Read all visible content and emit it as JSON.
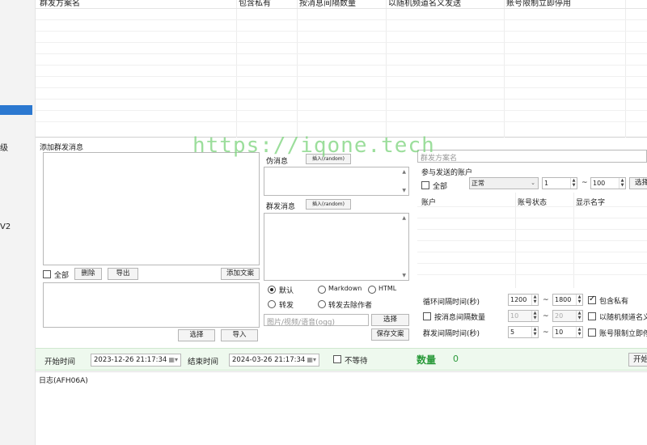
{
  "sidebar": {
    "items": [
      "级",
      "V2"
    ]
  },
  "top_grid": {
    "columns": [
      "群发方案名",
      "包含私有",
      "按消息间隔数量",
      "以随机频道名义发送",
      "账号限制立即停用"
    ]
  },
  "compose": {
    "title": "添加群发消息",
    "select_all": "全部",
    "delete": "删除",
    "export": "导出",
    "add_text": "添加文案",
    "select": "选择",
    "import": "导入"
  },
  "pseudo": {
    "label": "伪消息",
    "insert": "插入(random)"
  },
  "mass": {
    "label": "群发消息",
    "insert": "插入(random)"
  },
  "mode": {
    "default": "默认",
    "markdown": "Markdown",
    "html": "HTML",
    "forward": "转发",
    "forward_strip": "转发去除作者"
  },
  "media": {
    "placeholder": "图片/视频/语音(ogg)",
    "select": "选择",
    "save": "保存文案"
  },
  "plan": {
    "name_placeholder": "群发方案名",
    "accounts_title": "参与发送的账户",
    "select_all": "全部",
    "status_value": "正常",
    "from": "1",
    "tilde": "~",
    "to": "100",
    "select": "选择",
    "columns": [
      "账户",
      "账号状态",
      "显示名字"
    ]
  },
  "timing": {
    "loop_label": "循环间隔时间(秒)",
    "loop_min": "1200",
    "loop_max": "1800",
    "include_private": "包含私有",
    "by_count_label": "按消息间隔数量",
    "count_min": "10",
    "count_max": "20",
    "random_channel": "以随机频道名义",
    "mass_label": "群发间隔时间(秒)",
    "mass_min": "5",
    "mass_max": "10",
    "limit_stop": "账号限制立即停用"
  },
  "bottom": {
    "start_label": "开始时间",
    "start_value": "2023-12-26 21:17:34",
    "end_label": "结束时间",
    "end_value": "2024-03-26 21:17:34",
    "no_wait": "不等待",
    "count_label": "数量",
    "count_value": "0",
    "start_button": "开始"
  },
  "log": {
    "title": "日志(AFH06A)"
  },
  "watermark": "https://iqone.tech"
}
